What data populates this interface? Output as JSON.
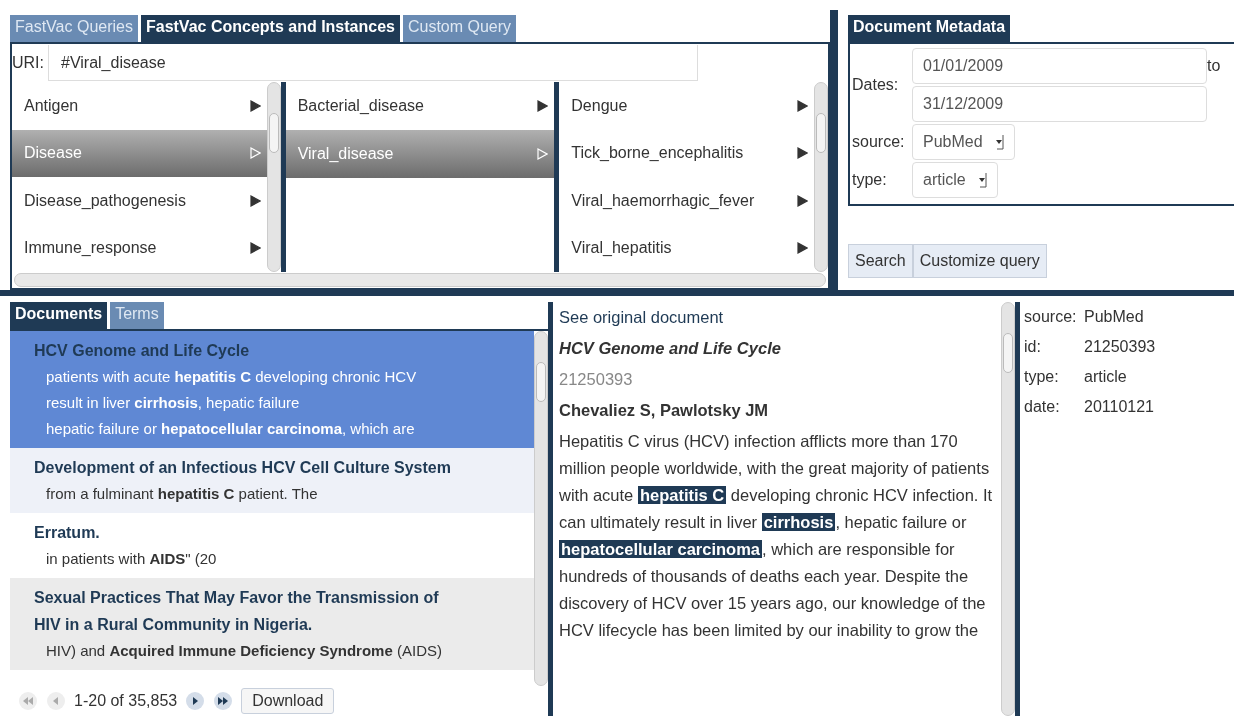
{
  "query_tabs": [
    {
      "label": "FastVac Queries",
      "selected": false
    },
    {
      "label": "FastVac Concepts and Instances",
      "selected": true
    },
    {
      "label": "Custom Query",
      "selected": false
    }
  ],
  "uri": {
    "label": "URI:",
    "value": "#Viral_disease"
  },
  "browser_columns": [
    {
      "items": [
        {
          "label": "Antigen",
          "selected": false
        },
        {
          "label": "Disease",
          "selected": true
        },
        {
          "label": "Disease_pathogenesis",
          "selected": false
        },
        {
          "label": "Immune_response",
          "selected": false
        }
      ]
    },
    {
      "items": [
        {
          "label": "Bacterial_disease",
          "selected": false
        },
        {
          "label": "Viral_disease",
          "selected": true
        }
      ]
    },
    {
      "items": [
        {
          "label": "Dengue",
          "selected": false
        },
        {
          "label": "Tick_borne_encephalitis",
          "selected": false
        },
        {
          "label": "Viral_haemorrhagic_fever",
          "selected": false
        },
        {
          "label": "Viral_hepatitis",
          "selected": false
        }
      ]
    }
  ],
  "metadata": {
    "tab": "Document Metadata",
    "dates_label": "Dates:",
    "date_from": "01/01/2009",
    "to_label": "to",
    "date_to": "31/12/2009",
    "source_label": "source:",
    "source_value": "PubMed",
    "type_label": "type:",
    "type_value": "article"
  },
  "actions": [
    "Search",
    "Customize query"
  ],
  "result_tabs": [
    {
      "label": "Documents",
      "selected": true
    },
    {
      "label": "Terms",
      "selected": false
    }
  ],
  "documents": [
    {
      "title": "HCV Genome and Life Cycle",
      "selected": true,
      "snippets": [
        "patients with acute **hepatitis C** developing chronic HCV",
        "result in liver **cirrhosis**, hepatic failure",
        "hepatic failure or **hepatocellular carcinoma**, which are"
      ]
    },
    {
      "title": "Development of an Infectious HCV Cell Culture System",
      "selected": false,
      "snippets": [
        "from a fulminant **hepatitis C** patient. The"
      ]
    },
    {
      "title": "Erratum.",
      "selected": false,
      "snippets": [
        "in patients with **AIDS**\" (20"
      ]
    },
    {
      "title": "Sexual Practices That May Favor the Transmission of HIV in a Rural Community in Nigeria.",
      "selected": false,
      "snippets": [
        "HIV) and **Acquired Immune Deficiency Syndrome** (AIDS)"
      ]
    }
  ],
  "pager": {
    "range": "1-20 of 35,853",
    "download": "Download"
  },
  "document_view": {
    "link": "See original document",
    "title": "HCV Genome and Life Cycle",
    "id": "21250393",
    "authors": "Chevaliez S, Pawlotsky JM",
    "abstract": "Hepatitis C virus (HCV) infection afflicts more than 170 million people worldwide, with the great majority of patients with acute **hepatitis C** developing chronic HCV infection. It can ultimately result in liver **cirrhosis**, hepatic failure or **hepatocellular carcinoma**, which are responsible for hundreds of thousands of deaths each year. Despite the discovery of HCV over 15 years ago, our knowledge of the HCV lifecycle has been limited by our inability to grow the"
  },
  "document_fields": [
    {
      "key": "source:",
      "value": "PubMed"
    },
    {
      "key": "id:",
      "value": "21250393"
    },
    {
      "key": "type:",
      "value": "article"
    },
    {
      "key": "date:",
      "value": "20110121"
    }
  ]
}
